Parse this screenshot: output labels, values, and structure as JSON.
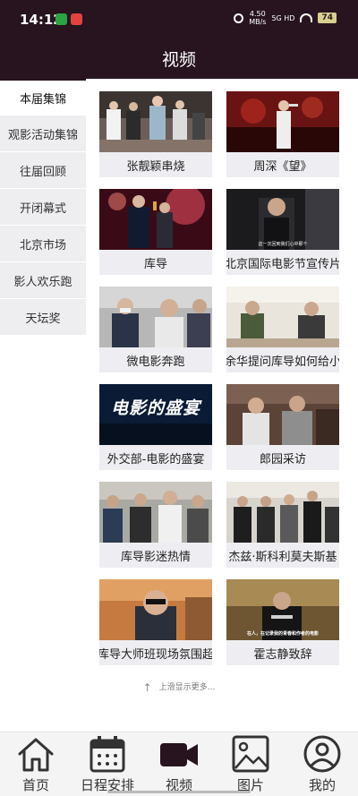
{
  "status_bar": {
    "time": "14:12",
    "speed_value": "4.50",
    "speed_unit": "MB/s",
    "signal": "5G HD",
    "battery": "74"
  },
  "header": {
    "title": "视频"
  },
  "sidebar": {
    "items": [
      {
        "label": "本届集锦",
        "active": true
      },
      {
        "label": "观影活动集锦",
        "active": false
      },
      {
        "label": "往届回顾",
        "active": false
      },
      {
        "label": "开闭幕式",
        "active": false
      },
      {
        "label": "北京市场",
        "active": false
      },
      {
        "label": "影人欢乐跑",
        "active": false
      },
      {
        "label": "天坛奖",
        "active": false
      }
    ]
  },
  "videos": [
    {
      "title": "张靓颖串烧",
      "thumb_text": ""
    },
    {
      "title": "周深《望》",
      "thumb_text": ""
    },
    {
      "title": "库导",
      "thumb_text": ""
    },
    {
      "title": "北京国际电影节宣传片",
      "thumb_text": "这一次回到我们心中那个"
    },
    {
      "title": "微电影奔跑",
      "thumb_text": ""
    },
    {
      "title": "余华提问库导如何给小",
      "thumb_text": ""
    },
    {
      "title": "外交部-电影的盛宴",
      "thumb_text": "电影的盛宴"
    },
    {
      "title": "郎园采访",
      "thumb_text": ""
    },
    {
      "title": "库导影迷热情",
      "thumb_text": ""
    },
    {
      "title": "杰兹·斯科利莫夫斯基",
      "thumb_text": ""
    },
    {
      "title": "库导大师班现场氛围超",
      "thumb_text": ""
    },
    {
      "title": "霍志静致辞",
      "thumb_text": "在人，在记录我的青春和作者的电影"
    }
  ],
  "more_hint": "上滑显示更多...",
  "tabbar": {
    "tabs": [
      {
        "label": "首页",
        "icon": "home-icon"
      },
      {
        "label": "日程安排",
        "icon": "calendar-icon"
      },
      {
        "label": "视频",
        "icon": "video-camera-icon",
        "active": true
      },
      {
        "label": "图片",
        "icon": "image-icon"
      },
      {
        "label": "我的",
        "icon": "user-icon"
      }
    ]
  },
  "colors": {
    "header_bg": "#27141f",
    "sidebar_bg": "#eeeef1",
    "caption_bg": "#eeeef2"
  }
}
